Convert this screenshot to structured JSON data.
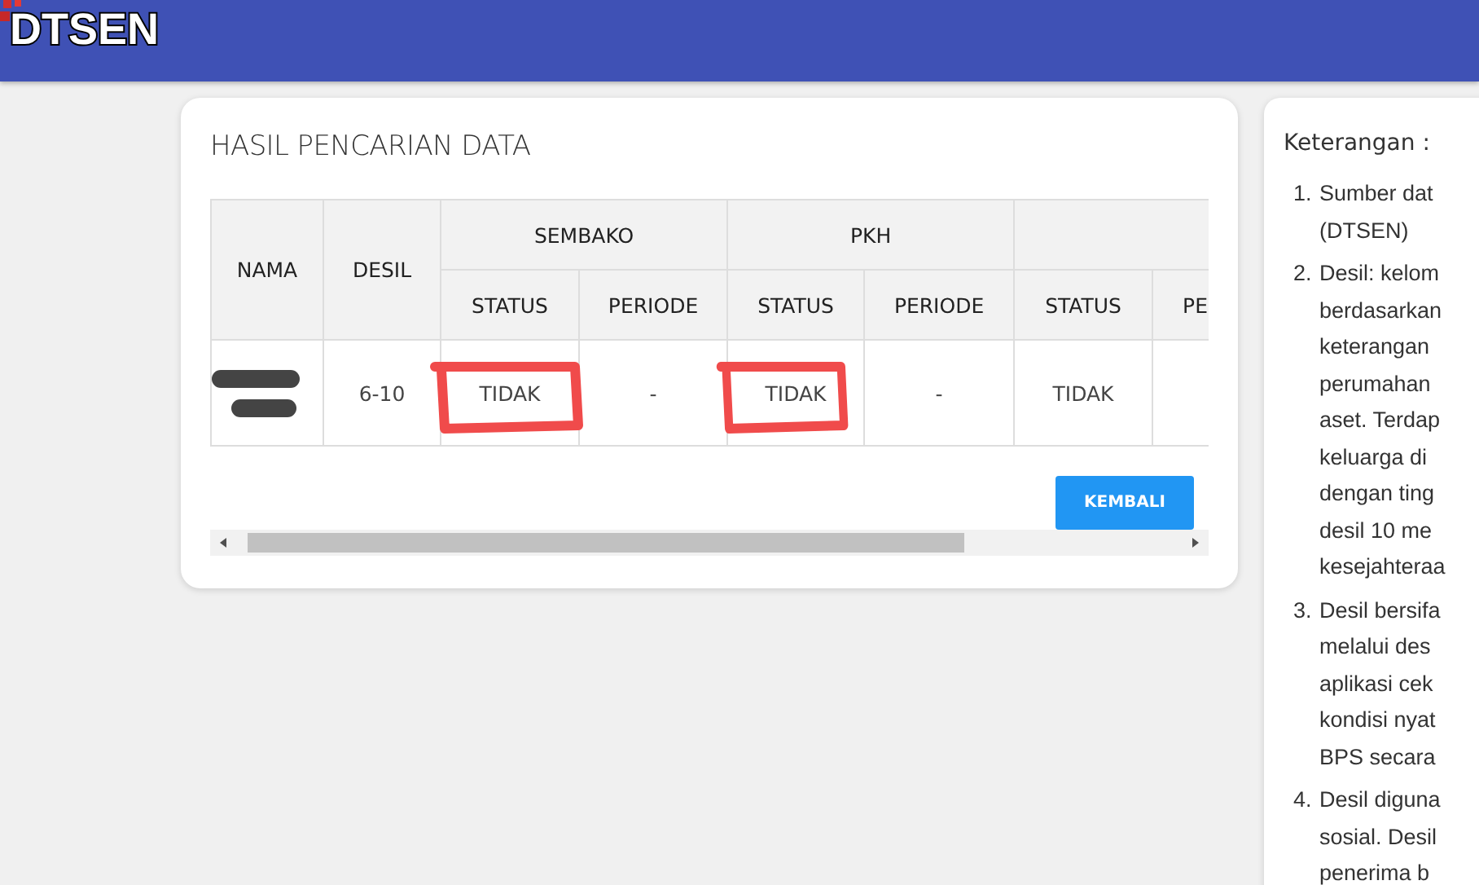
{
  "header": {
    "logo": "DTSEN"
  },
  "card": {
    "title": "HASIL PENCARIAN DATA",
    "table": {
      "fixed_columns": [
        "NAMA",
        "DESIL"
      ],
      "groups": [
        {
          "label": "SEMBAKO"
        },
        {
          "label": "PKH"
        }
      ],
      "sub_columns": [
        "STATUS",
        "PERIODE",
        "STATUS",
        "PERIODE",
        "STATUS",
        "PE"
      ],
      "rows": [
        {
          "nama": {
            "kind": "redacted"
          },
          "desil": "6-10",
          "cells": [
            {
              "text": "TIDAK",
              "circled": true
            },
            {
              "text": "-",
              "circled": false
            },
            {
              "text": "TIDAK",
              "circled": true
            },
            {
              "text": "-",
              "circled": false
            },
            {
              "text": "TIDAK",
              "circled": false
            }
          ]
        }
      ]
    },
    "button": "KEMBALI"
  },
  "notes": {
    "title": "Keterangan :",
    "items": [
      {
        "number": "1.",
        "lines": [
          "Sumber dat",
          "(DTSEN)"
        ]
      },
      {
        "number": "2.",
        "lines": [
          "Desil: kelom",
          "berdasarkan",
          "keterangan",
          "perumahan",
          "aset. Terdap",
          "keluarga di",
          "dengan ting",
          "desil 10 me",
          "kesejahteraa"
        ]
      },
      {
        "number": "3.",
        "lines": [
          "Desil bersifa",
          "melalui des",
          "aplikasi cek",
          "kondisi nyat",
          "BPS secara"
        ]
      },
      {
        "number": "4.",
        "lines": [
          "Desil diguna",
          "sosial. Desil",
          "penerima b"
        ]
      }
    ]
  }
}
